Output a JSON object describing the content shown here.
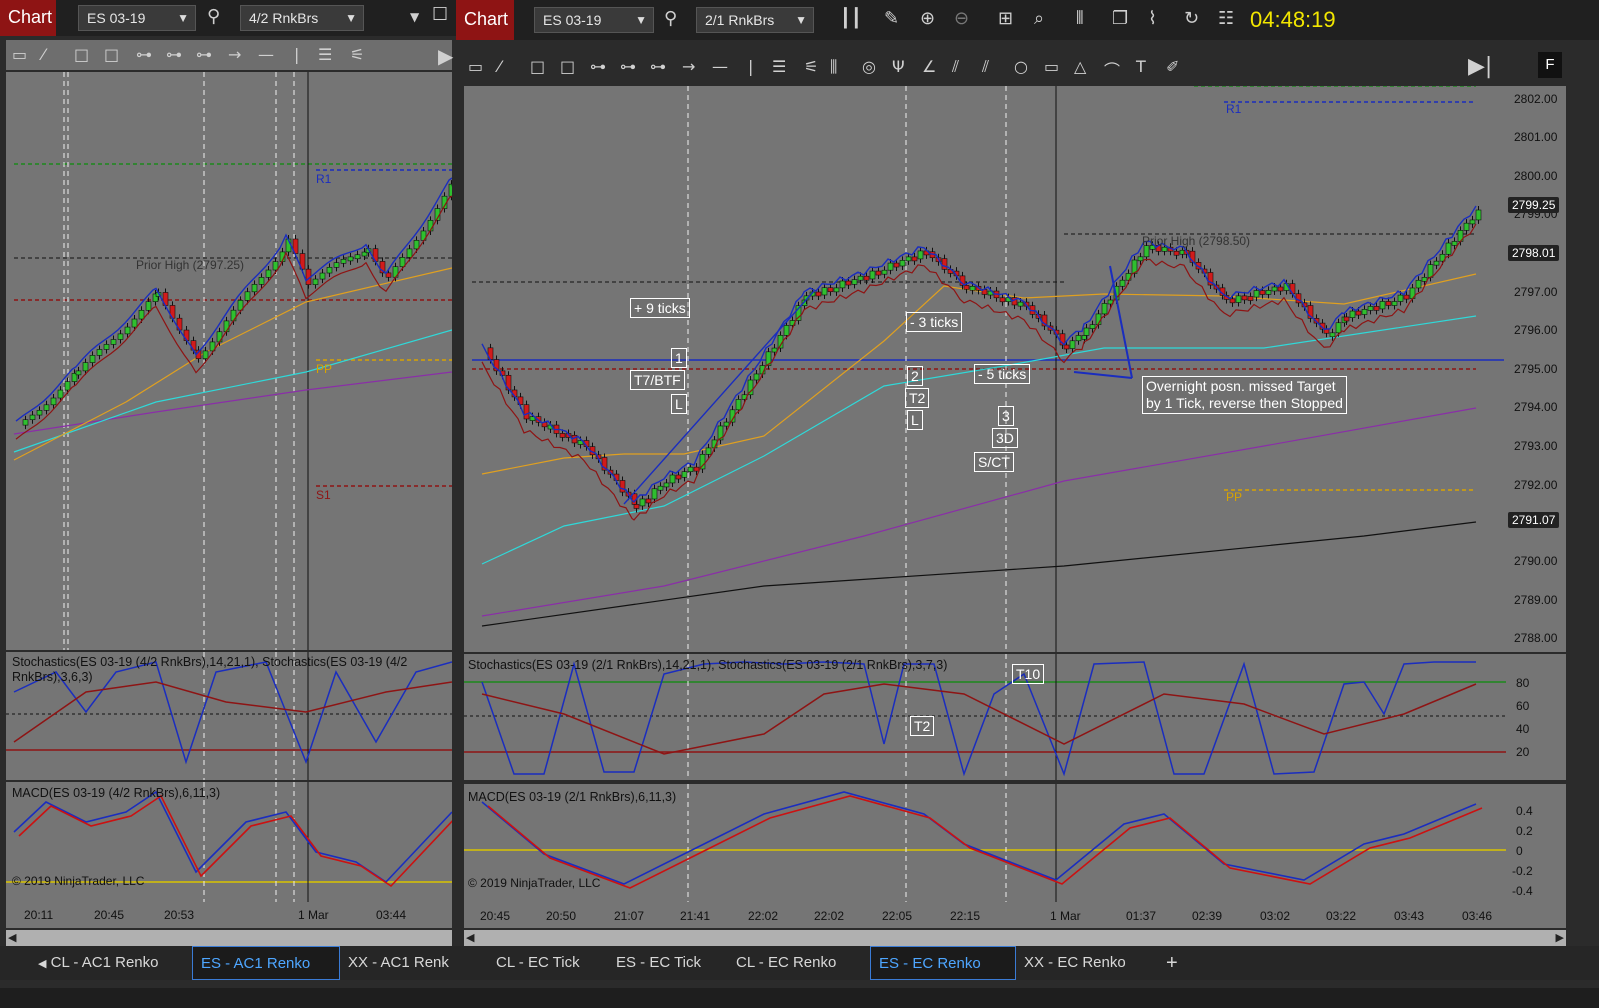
{
  "left": {
    "title": "Chart",
    "instrument": "ES 03-19",
    "bar_type": "4/2 RnkBrs",
    "price_labels": {
      "r1": "R1",
      "s1": "S1",
      "pp": "PP",
      "prior_high": "Prior High (2797.25)"
    },
    "stoch_label": "Stochastics(ES 03-19 (4/2 RnkBrs),14,21,1), Stochastics(ES 03-19 (4/2 RnkBrs),3,6,3)",
    "macd_label": "MACD(ES 03-19 (4/2 RnkBrs),6,11,3)",
    "copyright": "© 2019 NinjaTrader, LLC",
    "x_ticks": [
      "20:11",
      "20:45",
      "20:53",
      "1 Mar",
      "03:44"
    ],
    "tabs": [
      "CL - AC1 Renko",
      "ES - AC1 Renko",
      "XX - AC1 Renk"
    ],
    "active_tab": 1
  },
  "right": {
    "title": "Chart",
    "instrument": "ES 03-19",
    "bar_type": "2/1 RnkBrs",
    "clock": "04:48:19",
    "f_button": "F",
    "price_labels": {
      "r1": "R1",
      "pp": "PP",
      "prior_high": "Prior High (2798.50)"
    },
    "y_ticks": [
      "2802.00",
      "2801.00",
      "2800.00",
      "2799.00",
      "2797.00",
      "2796.00",
      "2795.00",
      "2794.00",
      "2793.00",
      "2792.00",
      "2790.00",
      "2789.00",
      "2788.00"
    ],
    "y_tags": [
      "2799.25",
      "2798.01",
      "2791.07"
    ],
    "annotations": {
      "plus9": "+ 9 ticks",
      "box1": "1",
      "t7btf": "T7/BTF",
      "l1": "L",
      "minus3": "- 3 ticks",
      "box2": "2",
      "t2": "T2",
      "l2": "L",
      "minus5": "- 5 ticks",
      "box3": "3",
      "box3d": "3D",
      "sct": "S/CT",
      "note_line1": "Overnight posn. missed Target",
      "note_line2": "by 1 Tick, reverse then Stopped",
      "t10": "T10",
      "t2b": "T2"
    },
    "stoch_label": "Stochastics(ES 03-19 (2/1 RnkBrs),14,21,1), Stochastics(ES 03-19 (2/1 RnkBrs),3,7,3)",
    "stoch_ticks": [
      "80",
      "60",
      "40",
      "20"
    ],
    "macd_label": "MACD(ES 03-19 (2/1 RnkBrs),6,11,3)",
    "macd_ticks": [
      "0.4",
      "0.2",
      "0",
      "-0.2",
      "-0.4"
    ],
    "copyright": "© 2019 NinjaTrader, LLC",
    "x_ticks": [
      "20:45",
      "20:50",
      "21:07",
      "21:41",
      "22:02",
      "22:02",
      "22:05",
      "22:15",
      "1 Mar",
      "01:37",
      "02:39",
      "03:02",
      "03:22",
      "03:43",
      "03:46"
    ],
    "tabs": [
      "CL - EC Tick",
      "ES - EC Tick",
      "CL - EC Renko",
      "ES - EC Renko",
      "XX - EC Renko"
    ],
    "active_tab": 3,
    "add_tab": "+"
  },
  "colors": {
    "chart_bg": "#757575",
    "up_bar": "#2fbf2f",
    "down_bar": "#d11b1b",
    "accent_red": "#8e1414",
    "clock": "#f2e600",
    "active_tab": "#4ea6ff"
  }
}
